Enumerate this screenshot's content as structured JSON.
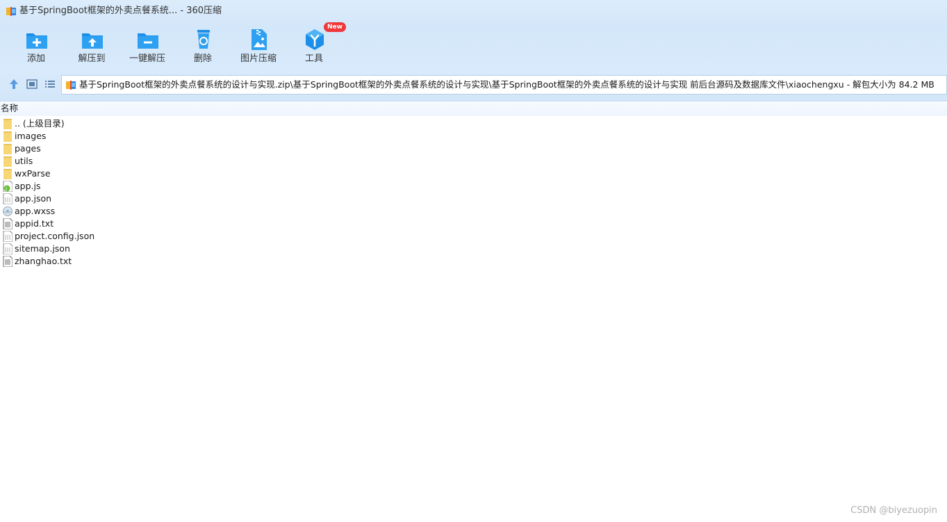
{
  "window": {
    "title": "基于SpringBoot框架的外卖点餐系统... - 360压缩"
  },
  "toolbar": {
    "items": [
      {
        "label": "添加",
        "icon": "add-folder-icon"
      },
      {
        "label": "解压到",
        "icon": "extract-to-icon"
      },
      {
        "label": "一键解压",
        "icon": "one-click-extract-icon"
      },
      {
        "label": "删除",
        "icon": "recycle-bin-icon"
      },
      {
        "label": "图片压缩",
        "icon": "image-compress-icon"
      },
      {
        "label": "工具",
        "icon": "tools-cube-icon",
        "badge": "New"
      }
    ]
  },
  "nav": {
    "path": "基于SpringBoot框架的外卖点餐系统的设计与实现.zip\\基于SpringBoot框架的外卖点餐系统的设计与实现\\基于SpringBoot框架的外卖点餐系统的设计与实现 前后台源码及数据库文件\\xiaochengxu - 解包大小为 84.2 MB"
  },
  "list": {
    "column_header": "名称",
    "rows": [
      {
        "name": ".. (上级目录)",
        "type": "folder"
      },
      {
        "name": "images",
        "type": "folder"
      },
      {
        "name": "pages",
        "type": "folder"
      },
      {
        "name": "utils",
        "type": "folder"
      },
      {
        "name": "wxParse",
        "type": "folder"
      },
      {
        "name": "app.js",
        "type": "js"
      },
      {
        "name": "app.json",
        "type": "json"
      },
      {
        "name": "app.wxss",
        "type": "wxss"
      },
      {
        "name": "appid.txt",
        "type": "txt"
      },
      {
        "name": "project.config.json",
        "type": "json"
      },
      {
        "name": "sitemap.json",
        "type": "json"
      },
      {
        "name": "zhanghao.txt",
        "type": "txt"
      }
    ]
  },
  "watermark": "CSDN @biyezuopin",
  "colors": {
    "accent": "#1e8fe8",
    "folder": "#f7d774",
    "badge": "#f0383b"
  }
}
